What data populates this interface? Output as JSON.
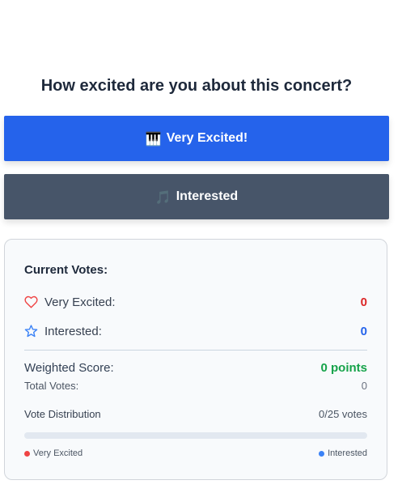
{
  "poll": {
    "question": "How excited are you about this concert?"
  },
  "buttons": {
    "very_excited": {
      "emoji": "🎹",
      "label": "Very Excited!"
    },
    "interested": {
      "emoji": "🎵",
      "label": "Interested"
    }
  },
  "votes": {
    "title": "Current Votes:",
    "very_excited_label": "Very Excited:",
    "very_excited_count": "0",
    "interested_label": "Interested:",
    "interested_count": "0",
    "weighted_score_label": "Weighted Score:",
    "weighted_score_value": "0 points",
    "total_votes_label": "Total Votes:",
    "total_votes_value": "0",
    "distribution_label": "Vote Distribution",
    "distribution_value": "0/25 votes",
    "distribution_fraction": 0,
    "legend_very_excited": "Very Excited",
    "legend_interested": "Interested"
  },
  "icons": {
    "very_excited": "heart-outline-icon",
    "interested": "star-outline-icon"
  },
  "colors": {
    "primary_blue": "#2563eb",
    "slate_button": "#475569",
    "red_count": "#dc2626",
    "green_score": "#16a34a",
    "legend_red": "#ef4444",
    "legend_blue": "#3b82f6"
  }
}
